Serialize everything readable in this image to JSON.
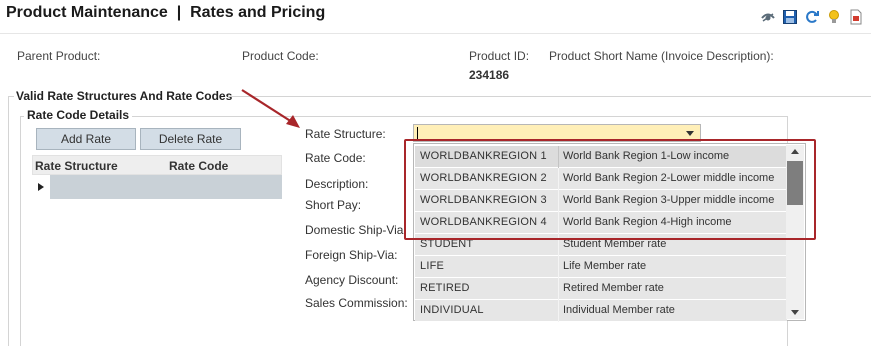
{
  "header": {
    "title": "Product Maintenance  |  Rates and Pricing",
    "toolbar_icons": [
      "view-icon",
      "save-icon",
      "refresh-icon",
      "lightbulb-icon",
      "pdf-export-icon"
    ]
  },
  "product": {
    "parent_product_label": "Parent Product:",
    "product_code_label": "Product Code:",
    "product_id_label": "Product ID:",
    "product_id_value": "234186",
    "short_name_label": "Product Short Name (Invoice Description):"
  },
  "rates": {
    "section_title": "Valid Rate Structures And Rate Codes",
    "group_title": "Rate Code Details",
    "add_button": "Add Rate",
    "delete_button": "Delete Rate",
    "grid_columns": [
      "Rate Structure",
      "Rate Code"
    ]
  },
  "form": {
    "labels": {
      "rate_structure": "Rate Structure:",
      "rate_code": "Rate Code:",
      "description": "Description:",
      "short_pay": "Short Pay:",
      "domestic_ship_via": "Domestic Ship-Via:",
      "foreign_ship_via": "Foreign Ship-Via:",
      "agency_discount": "Agency Discount:",
      "sales_commission": "Sales Commission:"
    },
    "rate_structure_value": ""
  },
  "dropdown": {
    "options": [
      {
        "code": "WORLDBANKREGION 1",
        "name": "World Bank Region 1-Low income"
      },
      {
        "code": "WORLDBANKREGION 2",
        "name": "World Bank Region 2-Lower middle income"
      },
      {
        "code": "WORLDBANKREGION 3",
        "name": "World Bank Region 3-Upper middle income"
      },
      {
        "code": "WORLDBANKREGION 4",
        "name": "World Bank Region 4-High income"
      },
      {
        "code": "STUDENT",
        "name": "Student Member rate"
      },
      {
        "code": "LIFE",
        "name": "Life Member rate"
      },
      {
        "code": "RETIRED",
        "name": "Retired Member rate"
      },
      {
        "code": "INDIVIDUAL",
        "name": "Individual Member rate"
      }
    ]
  },
  "colors": {
    "annotation_red": "#a8262a",
    "combo_bg": "#ffefb8",
    "button_bg": "#d3dde6",
    "grid_row_bg": "#c9d1d7"
  }
}
